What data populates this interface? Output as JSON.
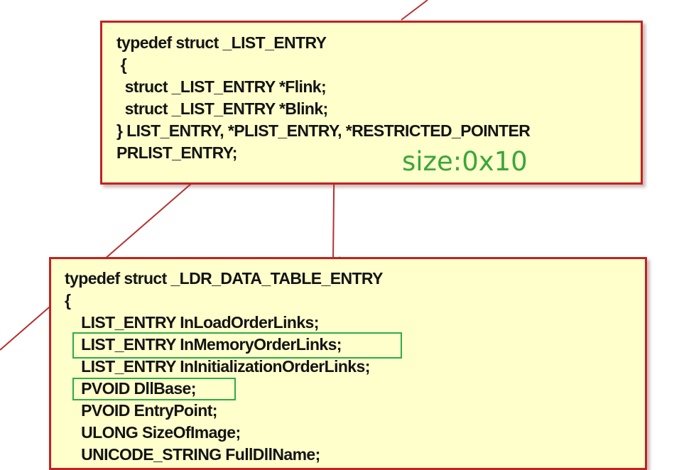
{
  "colors": {
    "box_fill": "#ffffcc",
    "box_border": "#c22222",
    "connector": "#b83030",
    "size_label": "#3aa63a",
    "highlight": "#2faa4b"
  },
  "list_entry": {
    "lines": [
      "typedef struct _LIST_ENTRY",
      " {",
      "  struct _LIST_ENTRY *Flink;",
      "  struct _LIST_ENTRY *Blink;",
      "} LIST_ENTRY, *PLIST_ENTRY, *RESTRICTED_POINTER",
      "PRLIST_ENTRY;"
    ],
    "size_note": "size:0x10"
  },
  "ldr_entry": {
    "lines": [
      "typedef struct _LDR_DATA_TABLE_ENTRY",
      "{",
      "    LIST_ENTRY InLoadOrderLinks;",
      "    LIST_ENTRY InMemoryOrderLinks;",
      "    LIST_ENTRY InInitializationOrderLinks;",
      "    PVOID DllBase;",
      "    PVOID EntryPoint;",
      "    ULONG SizeOfImage;",
      "    UNICODE_STRING FullDllName;"
    ],
    "highlighted": [
      "InMemoryOrderLinks",
      "DllBase"
    ]
  }
}
